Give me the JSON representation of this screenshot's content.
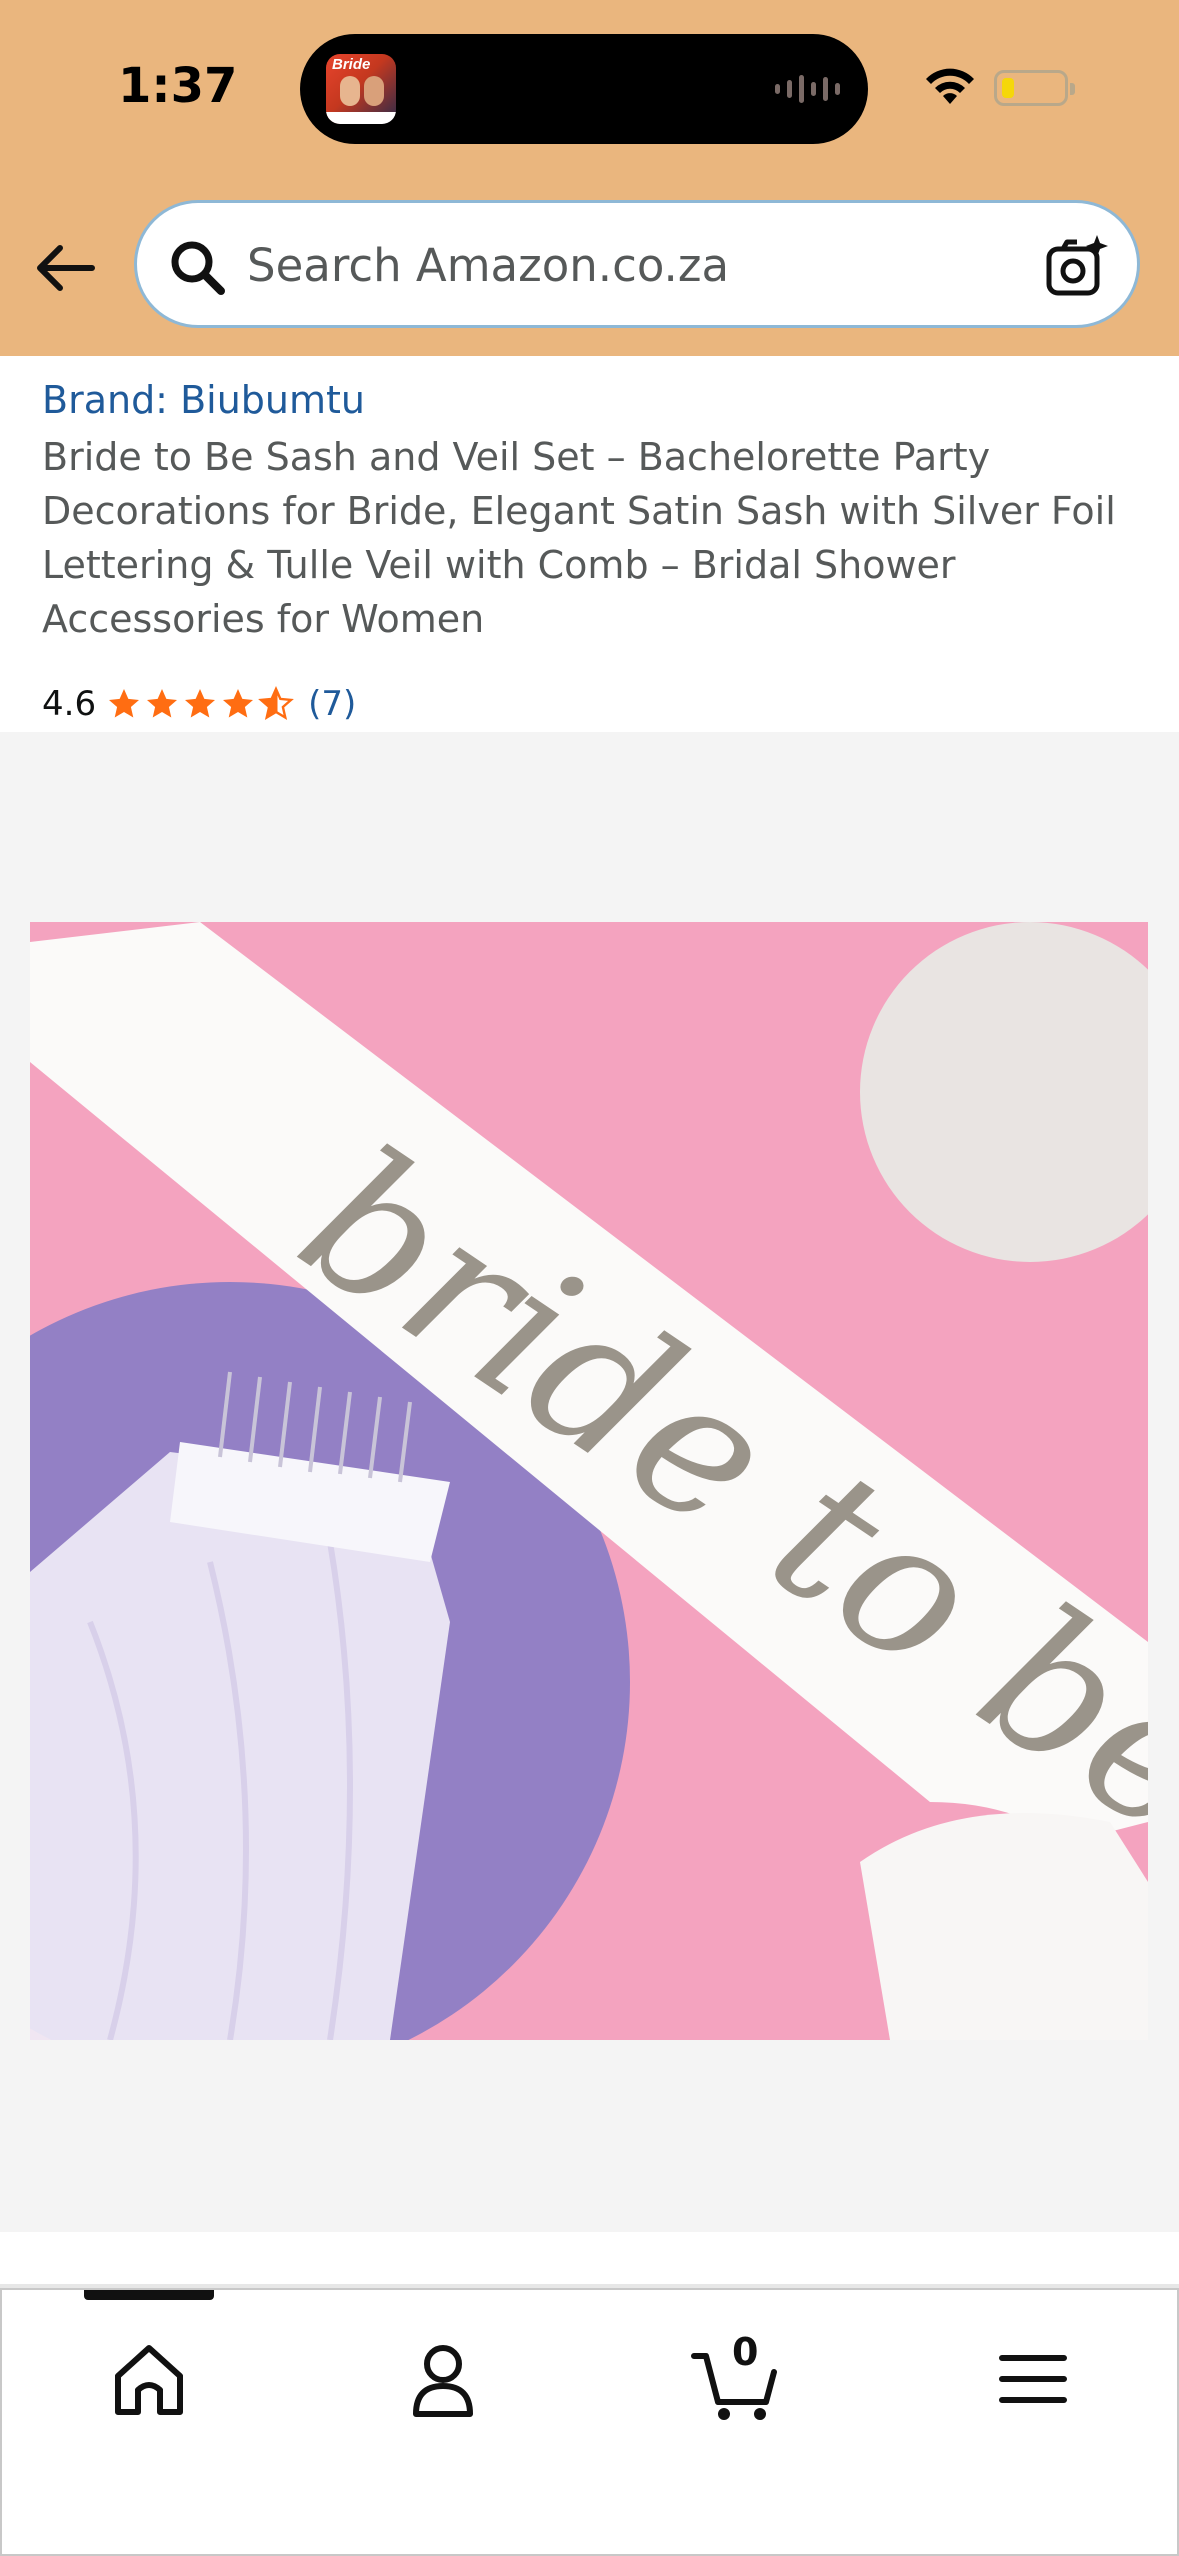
{
  "status_bar": {
    "time": "1:37",
    "island_thumb_text": "Bride",
    "battery_level": 0.2,
    "icons": [
      "wifi-icon",
      "battery-icon"
    ]
  },
  "header": {
    "search_placeholder": "Search Amazon.co.za",
    "icons": [
      "back-arrow-icon",
      "search-icon",
      "camera-search-icon"
    ],
    "background_color": "#eab67e"
  },
  "product": {
    "brand": "Brand: Biubumtu",
    "title": "Bride to Be Sash and Veil Set – Bachelorette Party Decorations for Bride, Elegant Satin Sash with Silver Foil Lettering & Tulle Veil with Comb – Bridal Shower Accessories for Women",
    "rating": "4.6",
    "rating_stars": 4.6,
    "review_count": "(7)",
    "image_sash_text": "bride to be"
  },
  "bottom_nav": {
    "items": [
      "home",
      "account",
      "cart",
      "menu"
    ],
    "active": "home",
    "cart_count": "0",
    "icons": [
      "home-icon",
      "account-icon",
      "cart-icon",
      "menu-icon"
    ]
  },
  "colors": {
    "link": "#1f5a9a",
    "star": "#ff6d12",
    "text_secondary": "#565959"
  }
}
